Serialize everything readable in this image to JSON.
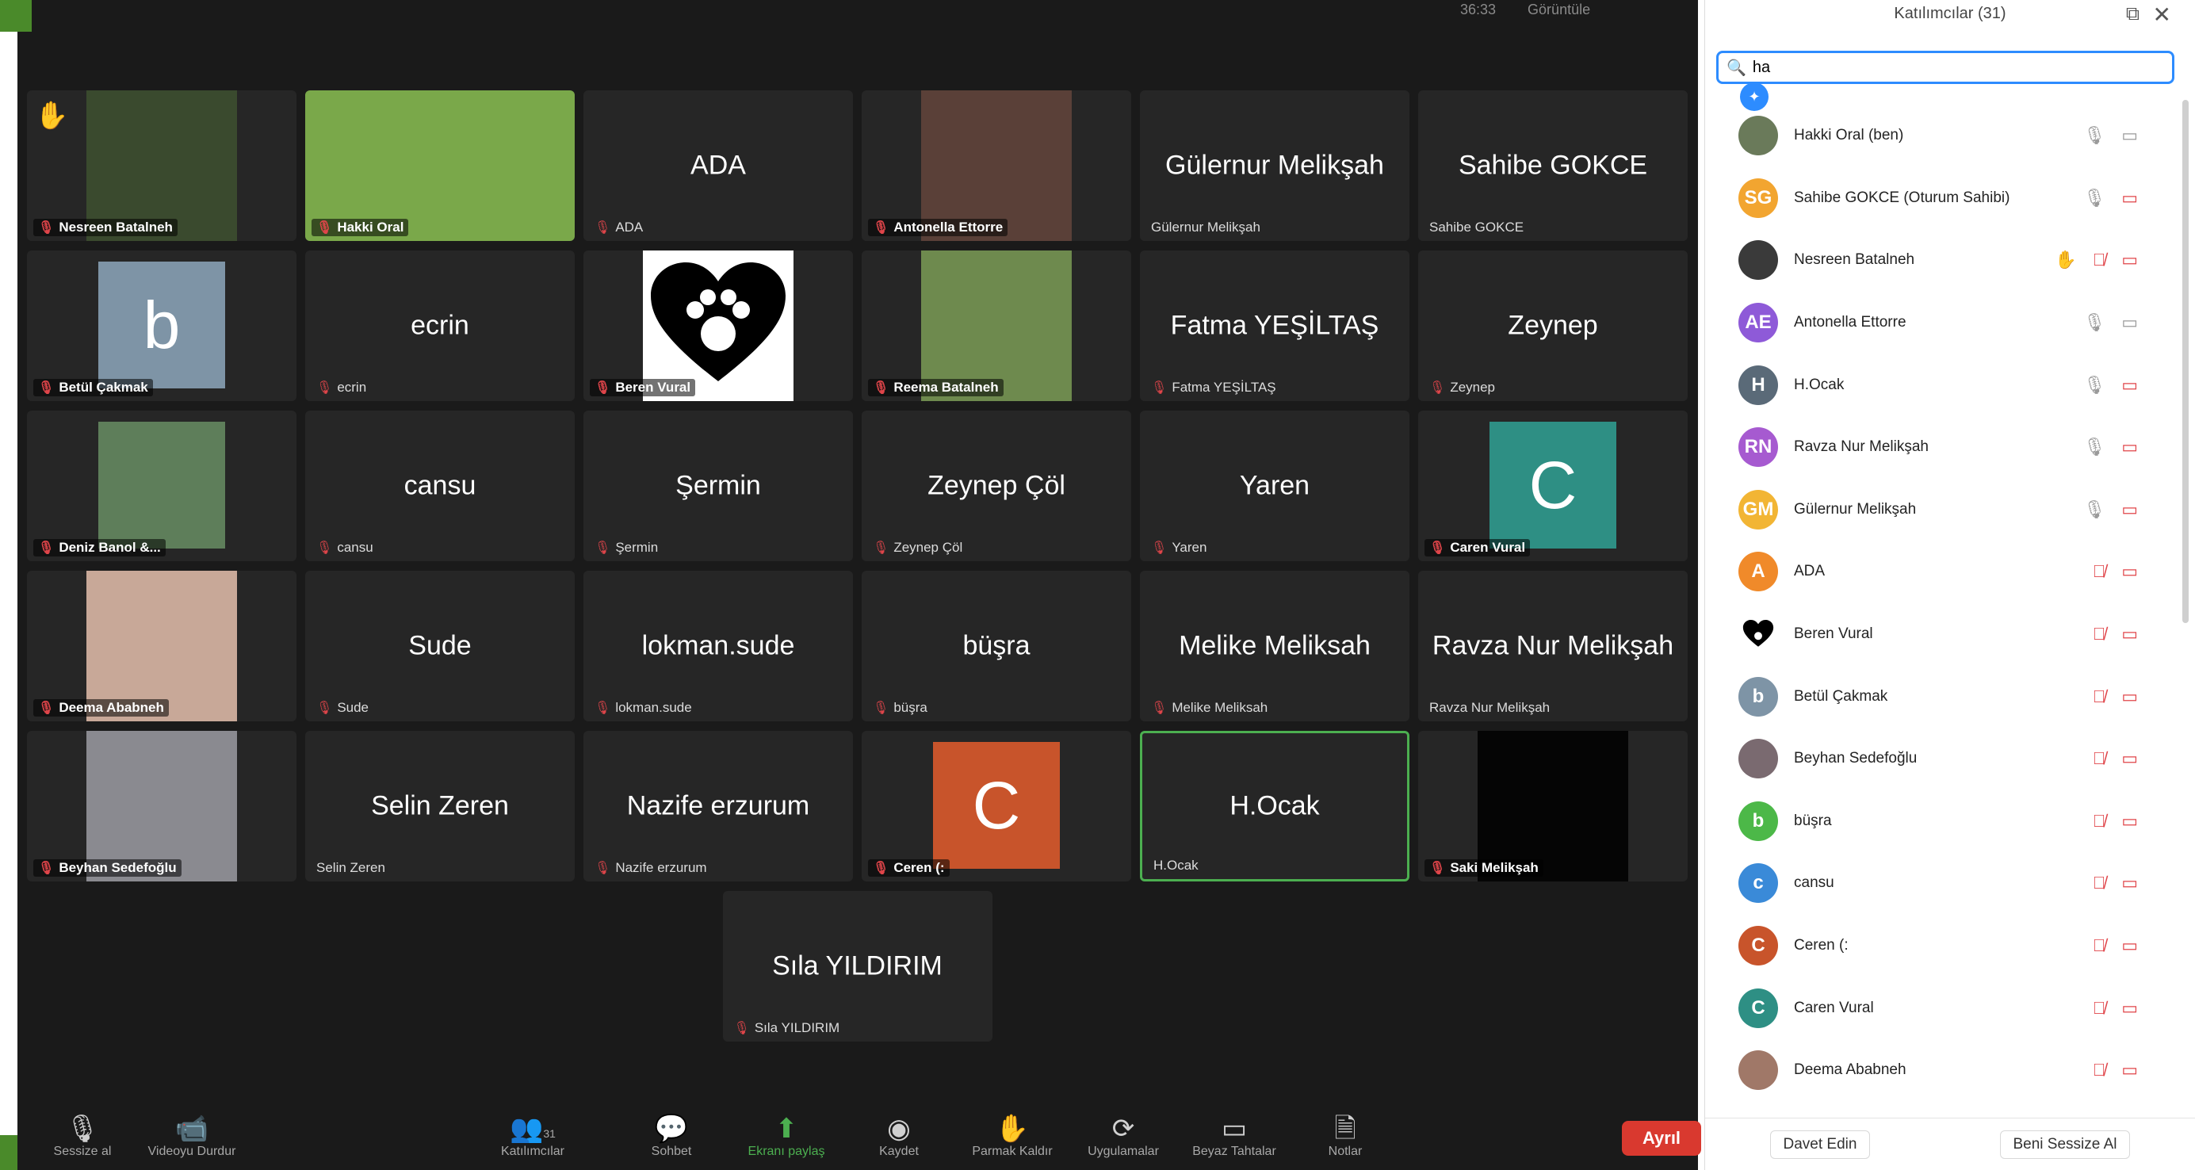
{
  "top_bar": {
    "time": "36:33",
    "view": "Görüntüle"
  },
  "tiles": [
    {
      "label": "Nesreen Batalneh",
      "big": "",
      "type": "photo",
      "bg": "#3a4a2e",
      "hand": true
    },
    {
      "label": "Hakki Oral",
      "big": "",
      "type": "photo",
      "bg": "#7aa84a"
    },
    {
      "label": "ADA",
      "big": "ADA",
      "type": "name"
    },
    {
      "label": "Antonella Ettorre",
      "big": "",
      "type": "photo",
      "bg": "#5a4038"
    },
    {
      "label": "Gülernur Melikşah",
      "big": "Gülernur Melikşah",
      "type": "name",
      "nomic": true
    },
    {
      "label": "Sahibe GOKCE",
      "big": "Sahibe GOKCE",
      "type": "name",
      "nomic": true
    },
    {
      "label": "Betül Çakmak",
      "big": "",
      "type": "avatar",
      "letter": "b",
      "bg": "#7e94a6"
    },
    {
      "label": "ecrin",
      "big": "ecrin",
      "type": "name"
    },
    {
      "label": "Beren Vural",
      "big": "",
      "type": "avatar",
      "letter": "",
      "bg": "#ffffff",
      "heart": true
    },
    {
      "label": "Reema Batalneh",
      "big": "",
      "type": "photo",
      "bg": "#6e8a4e"
    },
    {
      "label": "Fatma YEŞİLTAŞ",
      "big": "Fatma YEŞİLTAŞ",
      "type": "name"
    },
    {
      "label": "Zeynep",
      "big": "Zeynep",
      "type": "name"
    },
    {
      "label": "Deniz Banol &...",
      "big": "",
      "type": "avatar",
      "letter": "",
      "bg": "#5e7e5a"
    },
    {
      "label": "cansu",
      "big": "cansu",
      "type": "name"
    },
    {
      "label": "Şermin",
      "big": "Şermin",
      "type": "name"
    },
    {
      "label": "Zeynep Çöl",
      "big": "Zeynep Çöl",
      "type": "name"
    },
    {
      "label": "Yaren",
      "big": "Yaren",
      "type": "name"
    },
    {
      "label": "Caren Vural",
      "big": "",
      "type": "avatar",
      "letter": "C",
      "bg": "#2e8f84"
    },
    {
      "label": "Deema Ababneh",
      "big": "",
      "type": "photo",
      "bg": "#c8a898"
    },
    {
      "label": "Sude",
      "big": "Sude",
      "type": "name"
    },
    {
      "label": "lokman.sude",
      "big": "lokman.sude",
      "type": "name"
    },
    {
      "label": "büşra",
      "big": "büşra",
      "type": "name"
    },
    {
      "label": "Melike Meliksah",
      "big": "Melike Meliksah",
      "type": "name"
    },
    {
      "label": "Ravza Nur Melikşah",
      "big": "Ravza Nur Melikşah",
      "type": "name",
      "nomic": true
    },
    {
      "label": "Beyhan Sedefoğlu",
      "big": "",
      "type": "photo",
      "bg": "#8a8a90"
    },
    {
      "label": "Selin Zeren",
      "big": "Selin Zeren",
      "type": "name",
      "nomic": true
    },
    {
      "label": "Nazife erzurum",
      "big": "Nazife erzurum",
      "type": "name"
    },
    {
      "label": "Ceren (:",
      "big": "",
      "type": "avatar",
      "letter": "C",
      "bg": "#c8542b"
    },
    {
      "label": "H.Ocak",
      "big": "H.Ocak",
      "type": "name",
      "active": true,
      "nomic": true
    },
    {
      "label": "Saki Melikşah",
      "big": "",
      "type": "avatar",
      "letter": "",
      "bg": "#050505"
    },
    {
      "label": "Sıla YILDIRIM",
      "big": "Sıla YILDIRIM",
      "type": "name"
    }
  ],
  "toolbar": {
    "mute": "Sessize al",
    "video": "Videoyu Durdur",
    "participants": "Katılımcılar",
    "participants_count": "31",
    "chat": "Sohbet",
    "share": "Ekranı paylaş",
    "record": "Kaydet",
    "reactions": "Parmak Kaldır",
    "apps": "Uygulamalar",
    "whiteboard": "Beyaz Tahtalar",
    "notes": "Notlar",
    "leave": "Ayrıl"
  },
  "panel": {
    "title": "Katılımcılar (31)",
    "search_value": "ha",
    "footer_left": "Davet Edin",
    "footer_right": "Beni Sessize Al",
    "participants": [
      {
        "name": "Hakki Oral (ben)",
        "initials": "",
        "color": "#6a7a5a",
        "photo": true,
        "mic": "on",
        "video": "on"
      },
      {
        "name": "Sahibe GOKCE (Oturum Sahibi)",
        "initials": "SG",
        "color": "#f2a530",
        "mic": "on",
        "video": "off"
      },
      {
        "name": "Nesreen Batalneh",
        "initials": "",
        "color": "#3a3a3a",
        "photo": true,
        "mic": "off",
        "video": "off",
        "hand": true
      },
      {
        "name": "Antonella Ettorre",
        "initials": "AE",
        "color": "#8e5ad8",
        "mic": "on",
        "video": "on"
      },
      {
        "name": "H.Ocak",
        "initials": "H",
        "color": "#5a6a78",
        "mic": "on",
        "video": "off"
      },
      {
        "name": "Ravza Nur Melikşah",
        "initials": "RN",
        "color": "#a65ad0",
        "mic": "on",
        "video": "off"
      },
      {
        "name": "Gülernur Melikşah",
        "initials": "GM",
        "color": "#f2b534",
        "mic": "on",
        "video": "off"
      },
      {
        "name": "ADA",
        "initials": "A",
        "color": "#f08a2a",
        "mic": "off",
        "video": "off"
      },
      {
        "name": "Beren Vural",
        "initials": "",
        "color": "#ffffff",
        "heart": true,
        "mic": "off",
        "video": "off"
      },
      {
        "name": "Betül Çakmak",
        "initials": "b",
        "color": "#7e94a6",
        "mic": "off",
        "video": "off"
      },
      {
        "name": "Beyhan Sedefoğlu",
        "initials": "",
        "color": "#7a6a70",
        "photo": true,
        "mic": "off",
        "video": "off"
      },
      {
        "name": "büşra",
        "initials": "b",
        "color": "#4cb848",
        "mic": "off",
        "video": "off"
      },
      {
        "name": "cansu",
        "initials": "c",
        "color": "#3a8ad8",
        "mic": "off",
        "video": "off"
      },
      {
        "name": "Ceren (:",
        "initials": "C",
        "color": "#c8542b",
        "mic": "off",
        "video": "off"
      },
      {
        "name": "Caren Vural",
        "initials": "C",
        "color": "#2e8f84",
        "mic": "off",
        "video": "off"
      },
      {
        "name": "Deema Ababneh",
        "initials": "",
        "color": "#a07868",
        "photo": true,
        "mic": "off",
        "video": "off"
      }
    ]
  }
}
